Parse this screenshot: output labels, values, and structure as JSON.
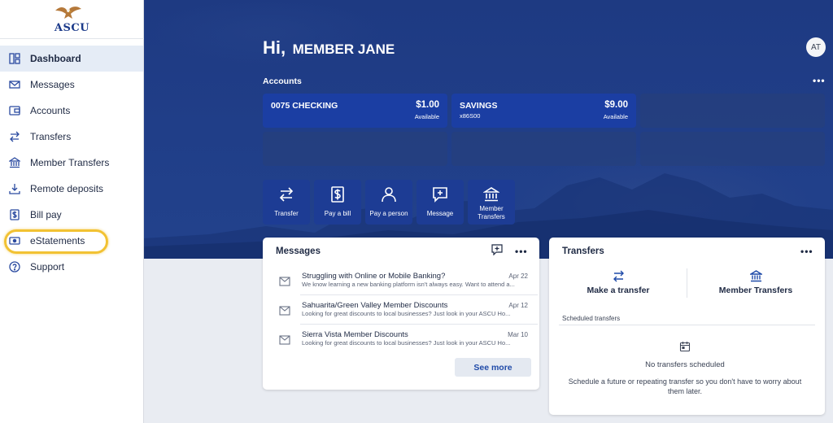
{
  "brand": {
    "logo_text": "ASCU"
  },
  "sidebar": {
    "items": [
      {
        "label": "Dashboard",
        "icon": "dashboard-icon",
        "active": true
      },
      {
        "label": "Messages",
        "icon": "envelope-icon"
      },
      {
        "label": "Accounts",
        "icon": "wallet-icon"
      },
      {
        "label": "Transfers",
        "icon": "transfer-arrows-icon"
      },
      {
        "label": "Member Transfers",
        "icon": "bank-icon"
      },
      {
        "label": "Remote deposits",
        "icon": "download-icon"
      },
      {
        "label": "Bill pay",
        "icon": "dollar-doc-icon"
      },
      {
        "label": "eStatements",
        "icon": "estatement-icon",
        "highlighted": true
      },
      {
        "label": "Support",
        "icon": "help-circle-icon"
      }
    ]
  },
  "header": {
    "greeting": "Hi,",
    "member_name": "MEMBER JANE",
    "avatar_initials": "AT"
  },
  "accounts": {
    "title": "Accounts",
    "more": "•••",
    "cards": [
      {
        "name": "0075 CHECKING",
        "sub": "",
        "balance": "$1.00",
        "balance_label": "Available"
      },
      {
        "name": "SAVINGS",
        "sub": "x86S00",
        "balance": "$9.00",
        "balance_label": "Available"
      }
    ]
  },
  "quick_actions": [
    {
      "label": "Transfer",
      "icon": "transfer-arrows-icon"
    },
    {
      "label": "Pay a bill",
      "icon": "dollar-doc-icon"
    },
    {
      "label": "Pay a person",
      "icon": "person-icon"
    },
    {
      "label": "Message",
      "icon": "message-plus-icon"
    },
    {
      "label": "Member Transfers",
      "icon": "bank-icon"
    }
  ],
  "messages": {
    "title": "Messages",
    "more": "•••",
    "items": [
      {
        "subject": "Struggling with Online or Mobile Banking?",
        "preview": "We know learning a new banking platform isn't always easy. Want to attend a...",
        "date": "Apr 22"
      },
      {
        "subject": "Sahuarita/Green Valley Member Discounts",
        "preview": "Looking for great discounts to local businesses? Just look in your ASCU Ho...",
        "date": "Apr 12"
      },
      {
        "subject": "Sierra Vista Member Discounts",
        "preview": "Looking for great discounts to local businesses? Just look in your ASCU Ho...",
        "date": "Mar 10"
      }
    ],
    "see_more": "See more"
  },
  "transfers": {
    "title": "Transfers",
    "more": "•••",
    "make_transfer": "Make a transfer",
    "member_transfers": "Member Transfers",
    "scheduled_label": "Scheduled transfers",
    "empty_title": "No transfers scheduled",
    "empty_hint": "Schedule a future or repeating transfer so you don't have to worry about them later."
  },
  "colors": {
    "brand_blue": "#1d3c94",
    "highlight_yellow": "#f2c233",
    "link_blue": "#1f4aa8"
  }
}
